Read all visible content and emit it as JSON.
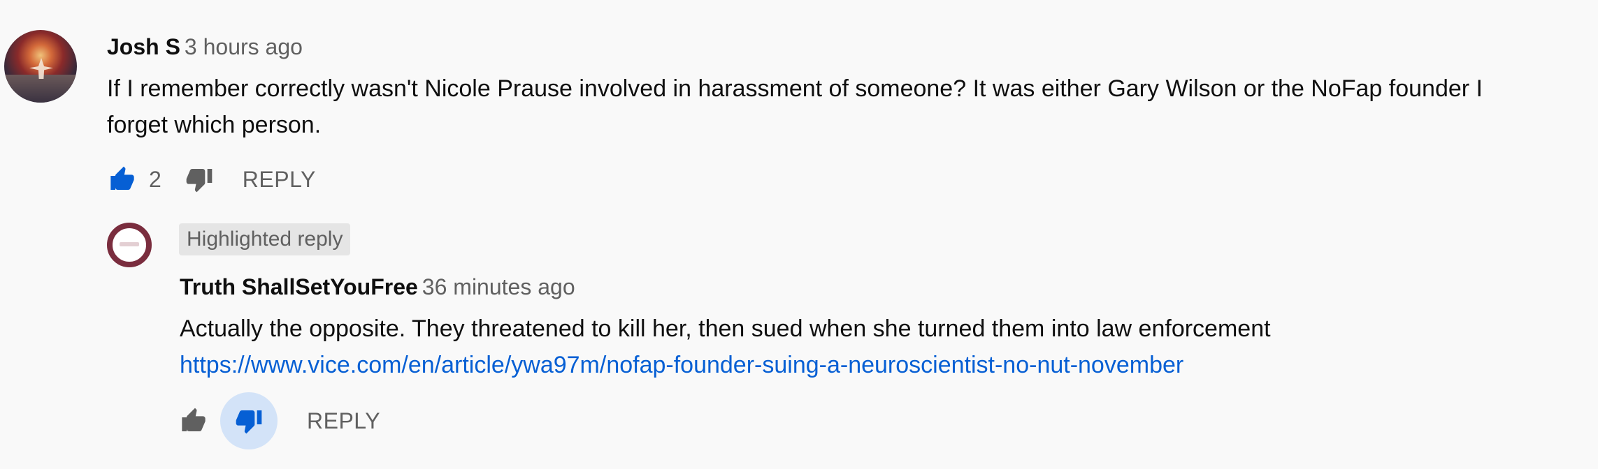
{
  "comment": {
    "author": "Josh S",
    "time": "3 hours ago",
    "text_line1": "If I remember correctly wasn't Nicole Prause involved in harassment of someone? It was either Gary Wilson or the NoFap founder I",
    "text_line2": "forget which person.",
    "like_count": "2",
    "reply_label": "REPLY"
  },
  "reply": {
    "badge": "Highlighted reply",
    "author": "Truth ShallSetYouFree",
    "time": "36 minutes ago",
    "text": "Actually the opposite. They threatened to kill her, then sued when she turned them into law enforcement",
    "link": "https://www.vice.com/en/article/ywa97m/nofap-founder-suing-a-neuroscientist-no-nut-november",
    "reply_label": "REPLY"
  },
  "colors": {
    "background": "#f9f9f9",
    "link": "#065fd4",
    "like_active": "#065fd4",
    "icon_inactive": "#606060",
    "selected_bg": "#d3e3f8"
  },
  "icons": {
    "like": "thumb-up-icon",
    "dislike": "thumb-down-icon"
  }
}
